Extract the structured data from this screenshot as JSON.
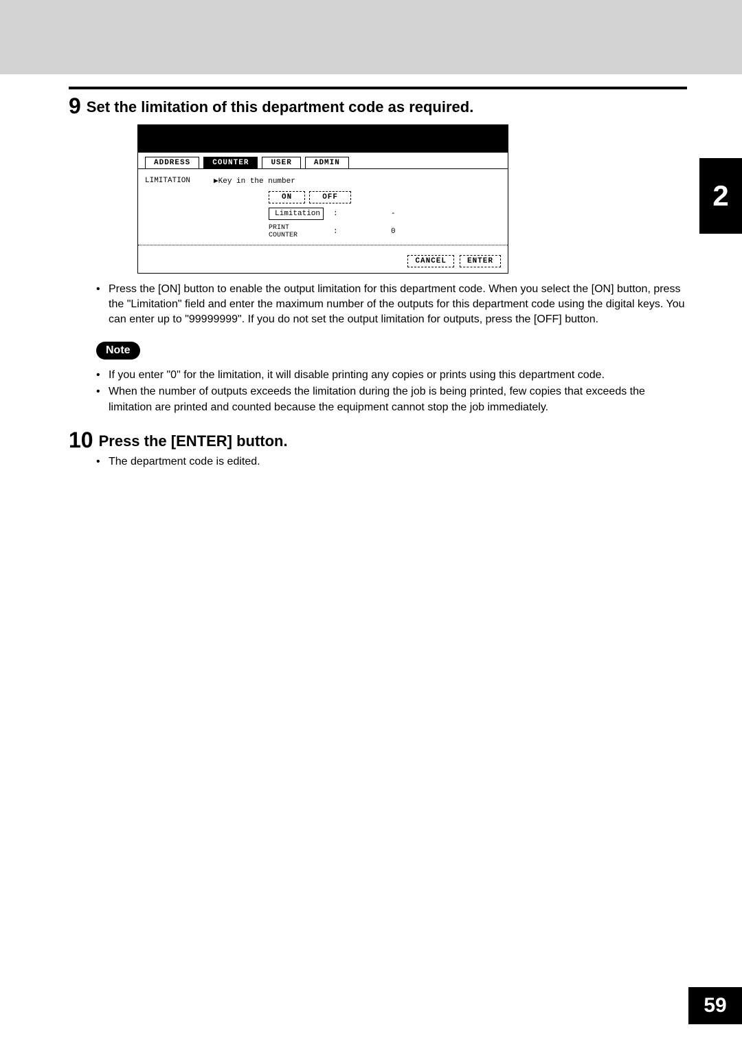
{
  "side_tab": "2",
  "page_number": "59",
  "step9": {
    "number": "9",
    "title": "Set the limitation of this department code as required.",
    "bullets": [
      "Press the [ON] button to enable the output limitation for this department code. When you select the [ON] button, press the \"Limitation\" field and enter the maximum number of the outputs for this department code using the digital keys. You can enter up to \"99999999\". If you do not set the output limitation for outputs, press the [OFF] button."
    ]
  },
  "screenshot": {
    "tabs": {
      "address": "ADDRESS",
      "counter": "COUNTER",
      "user": "USER",
      "admin": "ADMIN"
    },
    "row_label": "LIMITATION",
    "hint": "▶Key in the number",
    "on": "ON",
    "off": "OFF",
    "limitation_label": "Limitation",
    "limitation_value": "-",
    "print_counter_label": "PRINT\nCOUNTER",
    "print_counter_value": "0",
    "cancel": "CANCEL",
    "enter": "ENTER"
  },
  "note_label": "Note",
  "note_bullets": [
    "If you enter \"0\" for the limitation, it will disable printing any copies or prints using this department code.",
    "When the number of outputs exceeds the limitation during the job is being printed, few copies that exceeds the limitation are printed and counted because the equipment cannot stop the job immediately."
  ],
  "step10": {
    "number": "10",
    "title": "Press the [ENTER] button.",
    "bullets": [
      "The department code is edited."
    ]
  }
}
